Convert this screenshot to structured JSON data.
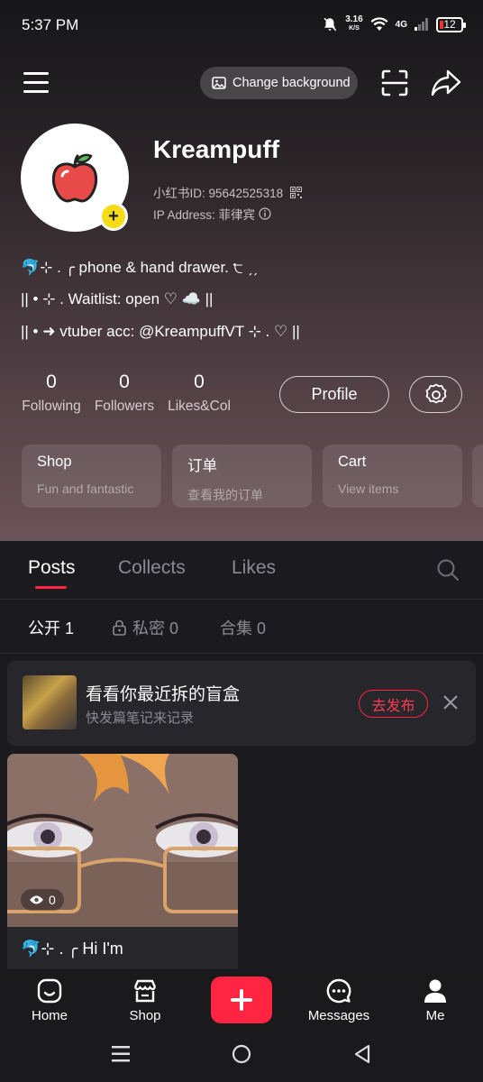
{
  "status_bar": {
    "time": "5:37 PM",
    "speed_value": "3.16",
    "speed_unit": "K/S",
    "network": "4G",
    "battery": "12"
  },
  "top_bar": {
    "change_background_label": "Change background"
  },
  "profile": {
    "username": "Kreampuff",
    "user_id": "小红书ID: 95642525318",
    "ip_address": "IP Address: 菲律宾",
    "bio": [
      "🐬⊹ .  ╭ phone & hand drawer. ੮ ˏˏ",
      "|| • ⊹ . Waitlist: open ♡ ☁️ ||",
      "|| • ➜ vtuber acc: @KreampuffVT ⊹ . ♡ ||"
    ]
  },
  "stats": [
    {
      "value": "0",
      "label": "Following"
    },
    {
      "value": "0",
      "label": "Followers"
    },
    {
      "value": "0",
      "label": "Likes&Col"
    }
  ],
  "buttons": {
    "profile_label": "Profile"
  },
  "services": [
    {
      "title": "Shop",
      "subtitle": "Fun and fantastic"
    },
    {
      "title": "订单",
      "subtitle": "查看我的订单"
    },
    {
      "title": "Cart",
      "subtitle": "View items"
    }
  ],
  "tabs": [
    {
      "label": "Posts",
      "active": true
    },
    {
      "label": "Collects",
      "active": false
    },
    {
      "label": "Likes",
      "active": false
    }
  ],
  "subtabs": [
    {
      "label": "公开 1",
      "active": true
    },
    {
      "label": "私密 0",
      "active": false
    },
    {
      "label": "合集 0",
      "active": false
    }
  ],
  "draft_banner": {
    "title": "看看你最近拆的盲盒",
    "subtitle": "快发篇笔记来记录",
    "publish_label": "去发布"
  },
  "post": {
    "views": "0",
    "title": "🐬⊹ .  ╭ Hi I'm"
  },
  "bottom_nav": [
    {
      "label": "Home"
    },
    {
      "label": "Shop"
    },
    {
      "label": "Messages"
    },
    {
      "label": "Me"
    }
  ],
  "colors": {
    "accent": "#ff2442",
    "avatar_badge": "#f5dc16"
  }
}
